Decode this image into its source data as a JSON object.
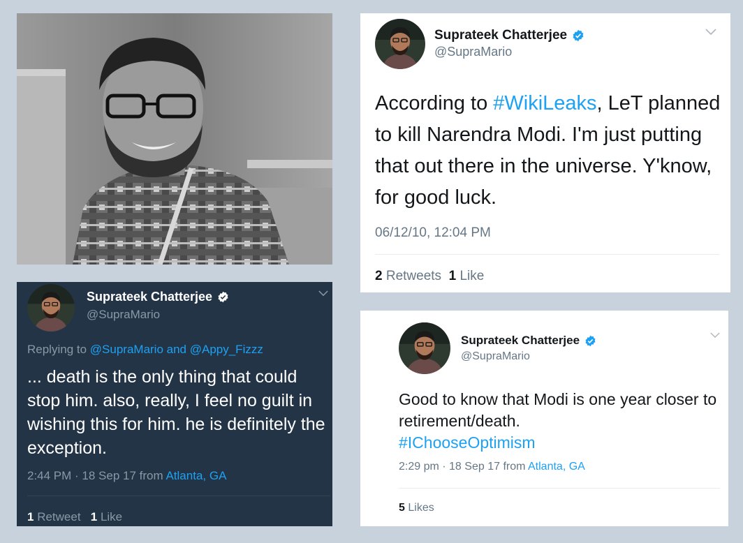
{
  "photo": {
    "description_icon": "person-photo"
  },
  "tweet_a": {
    "display_name": "Suprateek Chatterjee",
    "handle": "@SupraMario",
    "text_before": "According to ",
    "hashtag": "#WikiLeaks",
    "text_after": ", LeT planned to kill Narendra Modi. I'm just putting that out there in the universe. Y'know, for good luck.",
    "timestamp": "06/12/10, 12:04 PM",
    "retweets_count": "2",
    "retweets_label": "Retweets",
    "likes_count": "1",
    "likes_label": "Like"
  },
  "tweet_b": {
    "display_name": "Suprateek Chatterjee",
    "handle": "@SupraMario",
    "replying_prefix": "Replying to ",
    "replying_users": "@SupraMario and @Appy_Fizzz",
    "text": "... death is the only thing that could stop him. also, really, I feel no guilt in wishing this for him. he is definitely the exception.",
    "timestamp": "2:44 PM · 18 Sep 17",
    "from_label": "from",
    "location": "Atlanta, GA",
    "retweets_count": "1",
    "retweets_label": "Retweet",
    "likes_count": "1",
    "likes_label": "Like"
  },
  "tweet_c": {
    "display_name": "Suprateek Chatterjee",
    "handle": "@SupraMario",
    "text": "Good to know that Modi is one year closer to retirement/death.",
    "hashtag": "#IChooseOptimism",
    "timestamp": "2:29 pm · 18 Sep 17",
    "from_label": "from",
    "location": "Atlanta, GA",
    "likes_count": "5",
    "likes_label": "Likes"
  },
  "colors": {
    "page_background": "#c8d2dc",
    "link_blue": "#1da1f2",
    "dark_card": "#243447",
    "light_card": "#ffffff"
  }
}
